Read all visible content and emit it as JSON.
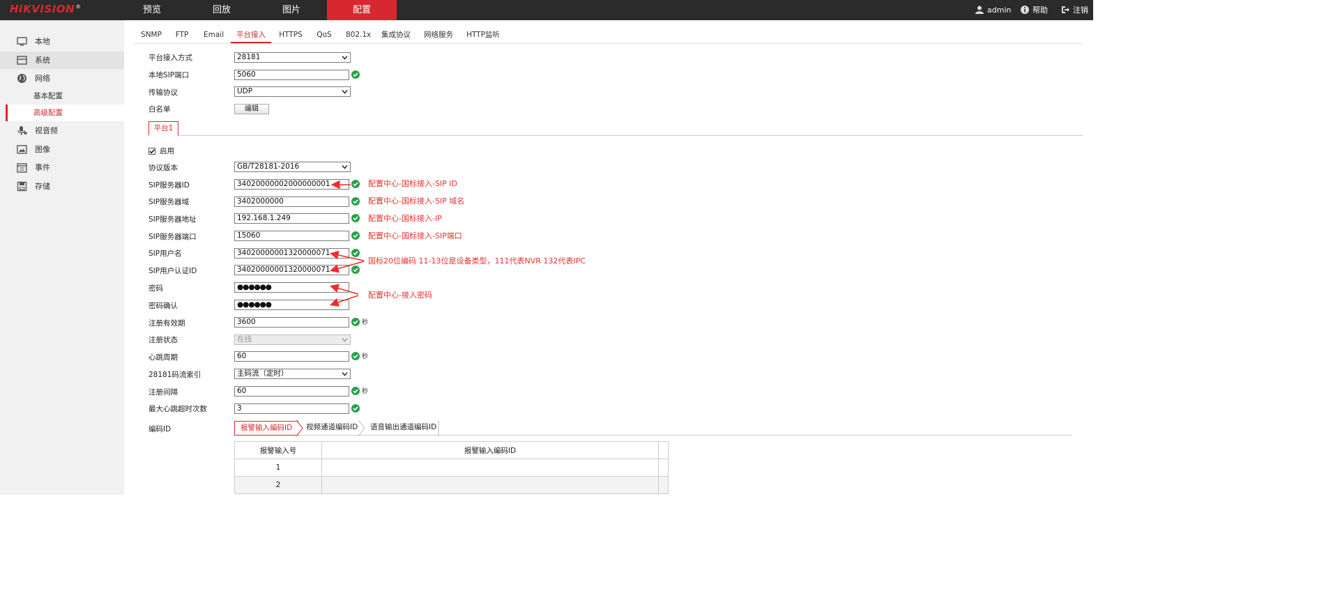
{
  "brand": {
    "logo": "HIKVISION",
    "reg": "®"
  },
  "nav": [
    "预览",
    "回放",
    "图片",
    "配置"
  ],
  "topright": {
    "user": "admin",
    "help": "帮助",
    "logout": "注销"
  },
  "sidebar": {
    "items": [
      "本地",
      "系统",
      "网络",
      "视音频",
      "图像",
      "事件",
      "存储"
    ],
    "sub": [
      "基本配置",
      "高级配置"
    ]
  },
  "tabs": [
    "SNMP",
    "FTP",
    "Email",
    "平台接入",
    "HTTPS",
    "QoS",
    "802.1x",
    "集成协议",
    "网络服务",
    "HTTP监听"
  ],
  "form": {
    "access_mode": {
      "label": "平台接入方式",
      "value": "28181"
    },
    "local_sip_port": {
      "label": "本地SIP端口",
      "value": "5060"
    },
    "transport": {
      "label": "传输协议",
      "value": "UDP"
    },
    "whitelist": {
      "label": "白名单",
      "button": "编辑"
    },
    "platform_tab": "平台1",
    "enable": "启用",
    "protocol_version": {
      "label": "协议版本",
      "value": "GB/T28181-2016"
    },
    "sip_server_id": {
      "label": "SIP服务器ID",
      "value": "34020000002000000001"
    },
    "sip_server_domain": {
      "label": "SIP服务器域",
      "value": "3402000000"
    },
    "sip_server_addr": {
      "label": "SIP服务器地址",
      "value": "192.168.1.249"
    },
    "sip_server_port": {
      "label": "SIP服务器端口",
      "value": "15060"
    },
    "sip_username": {
      "label": "SIP用户名",
      "value": "34020000001320000071"
    },
    "sip_auth_id": {
      "label": "SIP用户认证ID",
      "value": "34020000001320000071"
    },
    "password": {
      "label": "密码",
      "value": "●●●●●●"
    },
    "password_confirm": {
      "label": "密码确认",
      "value": "●●●●●●"
    },
    "reg_validity": {
      "label": "注册有效期",
      "value": "3600",
      "unit": "秒"
    },
    "reg_status": {
      "label": "注册状态",
      "value": "在线"
    },
    "heartbeat": {
      "label": "心跳周期",
      "value": "60",
      "unit": "秒"
    },
    "stream_index": {
      "label": "28181码流索引",
      "value": "主码流（定时）"
    },
    "reg_interval": {
      "label": "注册间隔",
      "value": "60",
      "unit": "秒"
    },
    "max_heartbeat_timeout": {
      "label": "最大心跳超时次数",
      "value": "3"
    },
    "code_id": {
      "label": "编码ID"
    }
  },
  "notes": {
    "sip_id": "配置中心-国标接入-SIP ID",
    "sip_domain": "配置中心-国标接入-SIP 域名",
    "ip": "配置中心-国标接入-IP",
    "sip_port": "配置中心-国标接入-SIP端口",
    "device_type": "国标20位编码 11-13位是设备类型，111代表NVR  132代表IPC",
    "password": "配置中心-接入密码"
  },
  "code_tabs": [
    "报警输入编码ID",
    "视频通道编码ID",
    "语音输出通道编码ID"
  ],
  "table": {
    "headers": [
      "报警输入号",
      "报警输入编码ID"
    ],
    "rows": [
      [
        "1",
        ""
      ],
      [
        "2",
        ""
      ]
    ]
  },
  "colors": {
    "accent": "#d7282f",
    "annotation": "#e8302f",
    "ok": "#2aa04a"
  }
}
